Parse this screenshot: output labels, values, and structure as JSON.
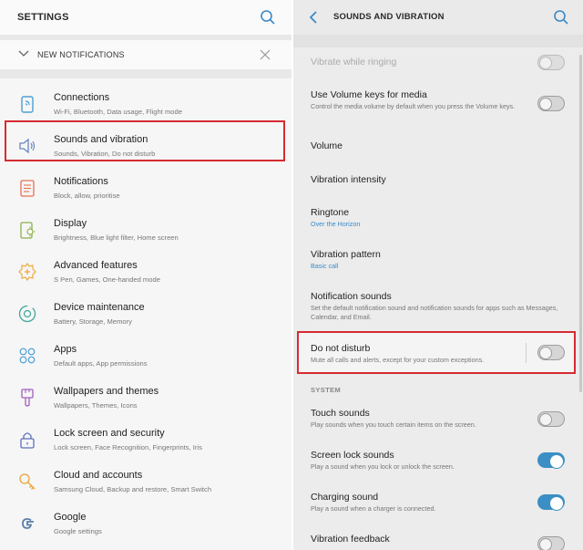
{
  "left": {
    "title": "SETTINGS",
    "notification_bar": {
      "label": "NEW NOTIFICATIONS"
    },
    "items": [
      {
        "label": "Connections",
        "sub": "Wi-Fi, Bluetooth, Data usage, Flight mode",
        "icon": "connections-icon"
      },
      {
        "label": "Sounds and vibration",
        "sub": "Sounds, Vibration, Do not disturb",
        "icon": "speaker-icon"
      },
      {
        "label": "Notifications",
        "sub": "Block, allow, prioritise",
        "icon": "notifications-icon"
      },
      {
        "label": "Display",
        "sub": "Brightness, Blue light filter, Home screen",
        "icon": "display-icon"
      },
      {
        "label": "Advanced features",
        "sub": "S Pen, Games, One-handed mode",
        "icon": "gear-plus-icon"
      },
      {
        "label": "Device maintenance",
        "sub": "Battery, Storage, Memory",
        "icon": "maintenance-icon"
      },
      {
        "label": "Apps",
        "sub": "Default apps, App permissions",
        "icon": "apps-icon"
      },
      {
        "label": "Wallpapers and themes",
        "sub": "Wallpapers, Themes, Icons",
        "icon": "brush-icon"
      },
      {
        "label": "Lock screen and security",
        "sub": "Lock screen, Face Recognition, Fingerprints, Iris",
        "icon": "lock-icon"
      },
      {
        "label": "Cloud and accounts",
        "sub": "Samsung Cloud, Backup and restore, Smart Switch",
        "icon": "key-icon"
      },
      {
        "label": "Google",
        "sub": "Google settings",
        "icon": "google-icon"
      }
    ]
  },
  "right": {
    "title": "SOUNDS AND VIBRATION",
    "items": [
      {
        "label": "Vibrate while ringing",
        "toggle": "off",
        "dimmed": true
      },
      {
        "label": "Use Volume keys for media",
        "sub": "Control the media volume by default when you press the Volume keys.",
        "toggle": "off"
      },
      {
        "label": "Volume"
      },
      {
        "label": "Vibration intensity"
      },
      {
        "label": "Ringtone",
        "sub": "Over the Horizon"
      },
      {
        "label": "Vibration pattern",
        "sub": "Basic call"
      },
      {
        "label": "Notification sounds",
        "sub": "Set the default notification sound and notification sounds for apps such as Messages, Calendar, and Email."
      },
      {
        "label": "Do not disturb",
        "sub": "Mute all calls and alerts, except for your custom exceptions.",
        "toggle": "off"
      }
    ],
    "section_system": "SYSTEM",
    "system_items": [
      {
        "label": "Touch sounds",
        "sub": "Play sounds when you touch certain items on the screen.",
        "toggle": "off"
      },
      {
        "label": "Screen lock sounds",
        "sub": "Play a sound when you lock or unlock the screen.",
        "toggle": "on"
      },
      {
        "label": "Charging sound",
        "sub": "Play a sound when a charger is connected.",
        "toggle": "on"
      },
      {
        "label": "Vibration feedback",
        "toggle": "off"
      }
    ]
  },
  "colors": {
    "highlight": "#d52b32",
    "accent": "#3b8fc4",
    "link": "#3a8ac9"
  }
}
